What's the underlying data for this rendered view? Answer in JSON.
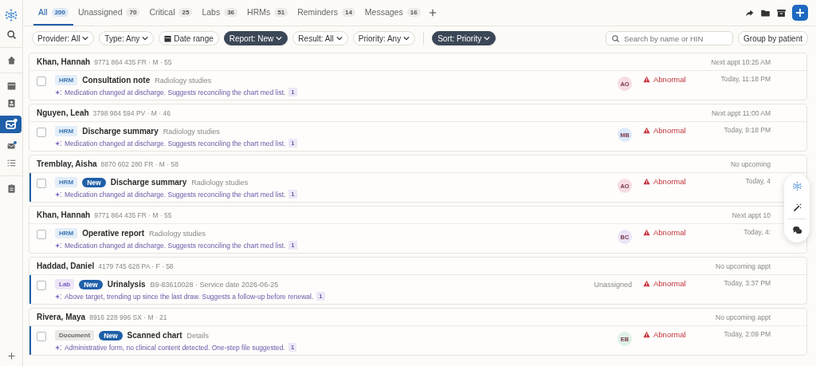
{
  "tabs": [
    {
      "label": "All",
      "count": "200",
      "selected": true
    },
    {
      "label": "Unassigned",
      "count": "70",
      "selected": false
    },
    {
      "label": "Critical",
      "count": "25",
      "selected": false
    },
    {
      "label": "Labs",
      "count": "36",
      "selected": false
    },
    {
      "label": "HRMs",
      "count": "51",
      "selected": false
    },
    {
      "label": "Reminders",
      "count": "14",
      "selected": false
    },
    {
      "label": "Messages",
      "count": "16",
      "selected": false
    }
  ],
  "filters": [
    {
      "label": "Provider: All",
      "kind": "dropdown",
      "selected": false
    },
    {
      "label": "Type: Any",
      "kind": "dropdown",
      "selected": false
    },
    {
      "label": "Date range",
      "kind": "date",
      "selected": false
    },
    {
      "label": "Report: New",
      "kind": "dropdown",
      "selected": true
    },
    {
      "label": "Result: All",
      "kind": "dropdown",
      "selected": false
    },
    {
      "label": "Priority: Any",
      "kind": "dropdown",
      "selected": false
    }
  ],
  "sort": {
    "label": "Sort: Priority",
    "selected": true
  },
  "search": {
    "placeholder": "Search by name or HIN"
  },
  "group_button": "Group by patient",
  "groups": [
    {
      "patient": "Khan, Hannah",
      "meta": "9771 864 435 FR · M · 55",
      "appt": "Next appt 10:25 AM",
      "items": [
        {
          "kind": "hrm",
          "tag": "HRM",
          "new": false,
          "title": "Consultation note",
          "subtitle": "Radiology studies",
          "summary": "Medication changed at discharge. Suggests reconciling the chart med list.",
          "count": "1",
          "assignee": "AO",
          "color": "#f6dde2",
          "status": "Abnormal",
          "time": "Today, 11:18 PM",
          "checked": false
        }
      ]
    },
    {
      "patient": "Nguyen, Leah",
      "meta": "3798 984 594 PV · M · 46",
      "appt": "Next appt 11:00 AM",
      "items": [
        {
          "kind": "hrm",
          "tag": "HRM",
          "new": false,
          "title": "Discharge summary",
          "subtitle": "Radiology studies",
          "summary": "Medication changed at discharge. Suggests reconciling the chart med list.",
          "count": "1",
          "assignee": "MB",
          "color": "#dceafa",
          "status": "Abnormal",
          "time": "Today, 9:18 PM",
          "checked": false
        }
      ]
    },
    {
      "patient": "Tremblay, Aisha",
      "meta": "8870 602 280 FR · M · 58",
      "appt": "No upcoming",
      "items": [
        {
          "kind": "hrm",
          "tag": "HRM",
          "new": true,
          "new_label": "New",
          "title": "Discharge summary",
          "subtitle": "Radiology studies",
          "summary": "Medication changed at discharge. Suggests reconciling the chart med list.",
          "count": "1",
          "assignee": "AO",
          "color": "#f6dde2",
          "status": "Abnormal",
          "time": "Today, 4",
          "checked": false
        }
      ]
    },
    {
      "patient": "Khan, Hannah",
      "meta": "9771 864 435 FR · M · 55",
      "appt": "Next appt 10",
      "items": [
        {
          "kind": "hrm",
          "tag": "HRM",
          "new": false,
          "title": "Operative report",
          "subtitle": "Radiology studies",
          "summary": "Medication changed at discharge. Suggests reconciling the chart med list.",
          "count": "1",
          "assignee": "BC",
          "color": "#ebe4f7",
          "status": "Abnormal",
          "time": "Today, 4:",
          "checked": false
        }
      ]
    },
    {
      "patient": "Haddad, Daniel",
      "meta": "4179 745 628 PA · F · 58",
      "appt": "No upcoming appt",
      "items": [
        {
          "kind": "lab",
          "tag": "Lab",
          "new": true,
          "new_label": "New",
          "title": "Urinalysis",
          "subtitle": "B9-83610028 · Service date 2026-06-25",
          "summary": "Above target, trending up since the last draw. Suggests a follow-up before renewal.",
          "count": "1",
          "assignee_text": "Unassigned",
          "status": "Abnormal",
          "time": "Today, 3:37 PM",
          "checked": false
        }
      ]
    },
    {
      "patient": "Rivera, Maya",
      "meta": "8916 228 996 SX · M · 21",
      "appt": "No upcoming appt",
      "items": [
        {
          "kind": "document",
          "tag": "Document",
          "new": true,
          "new_label": "New",
          "title": "Scanned chart",
          "subtitle": "Details",
          "summary": "Administrative form, no clinical content detected. One-step file suggested.",
          "count": "1",
          "assignee": "EB",
          "color": "#dff2e6",
          "status": "Abnormal",
          "time": "Today, 2:09 PM",
          "checked": false
        }
      ]
    }
  ]
}
